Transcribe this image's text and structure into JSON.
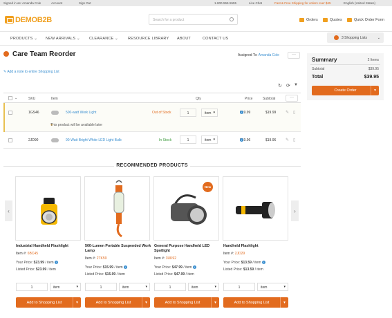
{
  "topbar": {
    "signed_in": "Signed in as: Amanda Cole",
    "account": "Account",
    "sign_out": "Sign Out",
    "phone": "1-800-555-5555",
    "live_chat": "Live Chat",
    "promo": "Fast & Free Shipping for orders over $45",
    "locale": "English (United States)"
  },
  "header": {
    "logo_text": "DEMOB2B",
    "search_placeholder": "Search for a product",
    "orders": "Orders",
    "quotes": "Quotes",
    "quick_order": "Quick Order Form"
  },
  "nav": {
    "items": [
      "PRODUCTS",
      "NEW ARRIVALS",
      "CLEARANCE",
      "RESOURCE LIBRARY",
      "ABOUT",
      "CONTACT US"
    ],
    "shopping_lists": "3 Shopping Lists"
  },
  "page": {
    "title": "Care Team Reorder",
    "assigned_to_label": "Assigned To:",
    "assigned_to": "Amanda Cole",
    "add_note": "Add a note to entire Shopping List"
  },
  "table": {
    "headers": {
      "sku": "SKU",
      "item": "Item",
      "qty": "Qty",
      "price": "Price",
      "subtotal": "Subtotal"
    },
    "rows": [
      {
        "sku": "1GS46",
        "name": "500-watt Work Light",
        "stock": "Out of Stock",
        "qty": "1",
        "unit": "item",
        "price": "$19.99",
        "subtotal": "$19.99",
        "note": "This product will be available later"
      },
      {
        "sku": "2JD90",
        "name": "90-Watt Bright White LED Light Bulb",
        "stock": "In Stock",
        "qty": "1",
        "unit": "item",
        "price": "$19.96",
        "subtotal": "$19.96"
      }
    ]
  },
  "summary": {
    "title": "Summary",
    "items_count": "2 Items",
    "subtotal_label": "Subtotal",
    "subtotal": "$39.95",
    "total_label": "Total",
    "total": "$39.95",
    "create_order": "Create Order"
  },
  "recommended": {
    "title": "RECOMMENDED PRODUCTS",
    "new_badge": "New",
    "your_price_label": "Your Price:",
    "listed_price_label": "Listed Price:",
    "item_label": "Item #:",
    "per_item": "/ item",
    "add_button": "Add to Shopping List",
    "products": [
      {
        "name": "Industrial Handheld Flashlight",
        "item_no": "6BC45",
        "your_price": "$23.99",
        "listed_price": "$23.99",
        "qty": "1",
        "unit": "item"
      },
      {
        "name": "500-Lumen Portable Suspended Work Lamp",
        "item_no": "2TK59",
        "your_price": "$15.99",
        "listed_price": "$15.99",
        "qty": "1",
        "unit": "item"
      },
      {
        "name": "General Purpose Handheld LED Spotlight",
        "item_no": "3UK92",
        "your_price": "$47.99",
        "listed_price": "$47.99",
        "qty": "1",
        "unit": "item"
      },
      {
        "name": "Handheld Flashlight",
        "item_no": "2JD29",
        "your_price": "$13.59",
        "listed_price": "$13.59",
        "qty": "1",
        "unit": "item"
      }
    ]
  },
  "colors": {
    "accent": "#e26b1e",
    "logo": "#f0a020",
    "link": "#3a8fd0",
    "in_stock": "#3a9a3a",
    "out_of_stock": "#e26b1e"
  }
}
